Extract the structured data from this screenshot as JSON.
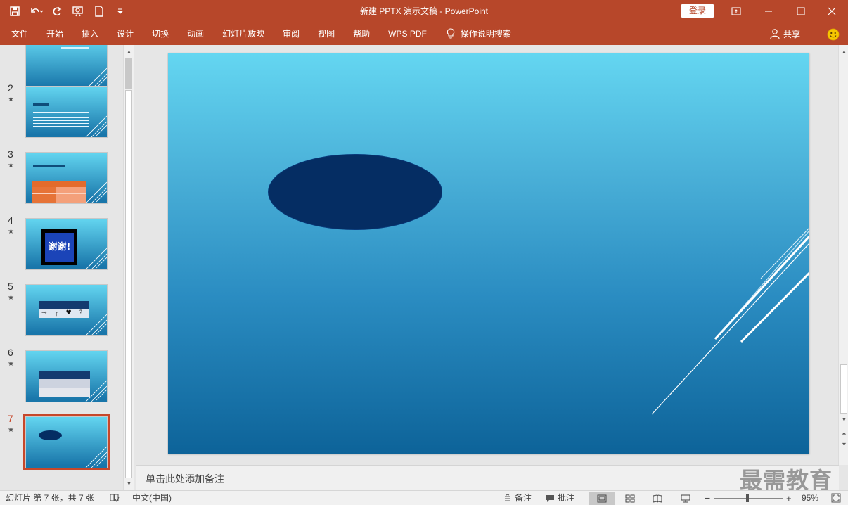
{
  "window": {
    "title": "新建 PPTX 演示文稿  -  PowerPoint",
    "login_label": "登录"
  },
  "menu": {
    "items": [
      "文件",
      "开始",
      "插入",
      "设计",
      "切换",
      "动画",
      "幻灯片放映",
      "审阅",
      "视图",
      "帮助",
      "WPS PDF"
    ],
    "search_hint": "操作说明搜索",
    "share_label": "共享"
  },
  "thumbnails": [
    {
      "number": "",
      "star": ""
    },
    {
      "number": "2",
      "star": "★"
    },
    {
      "number": "3",
      "star": "★"
    },
    {
      "number": "4",
      "star": "★",
      "text": "谢谢!"
    },
    {
      "number": "5",
      "star": "★"
    },
    {
      "number": "6",
      "star": "★"
    },
    {
      "number": "7",
      "star": "★"
    }
  ],
  "selected_slide": 7,
  "notes": {
    "placeholder": "单击此处添加备注"
  },
  "watermark": "最需教育",
  "status": {
    "slide_info": "幻灯片 第 7 张，共 7 张",
    "language": "中文(中国)",
    "notes_label": "备注",
    "comments_label": "批注",
    "zoom_percent": "95%",
    "zoom_level": 0.48,
    "zoom_minus": "−",
    "zoom_plus": "+"
  },
  "colors": {
    "ribbon": "#b7472a",
    "oval_fill": "#052d63",
    "selection": "#c7472a"
  }
}
